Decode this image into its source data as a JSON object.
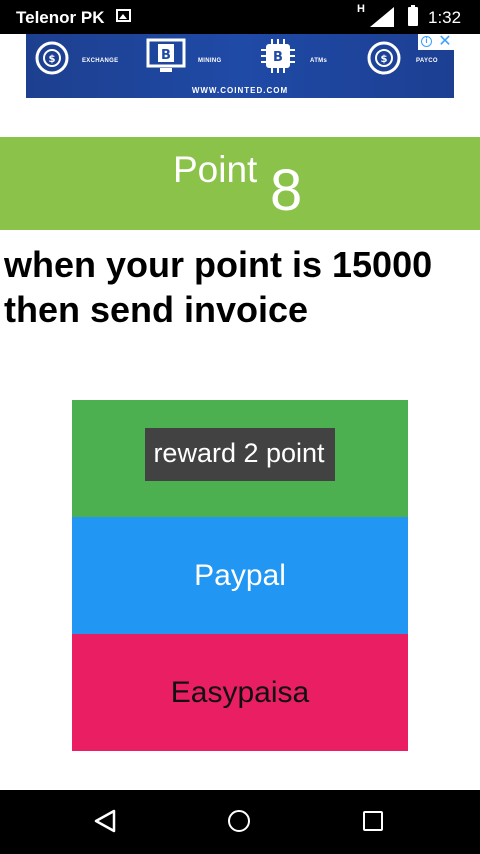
{
  "status_bar": {
    "carrier": "Telenor PK",
    "network_type": "H",
    "time": "1:32",
    "icons": [
      "gallery-icon",
      "signal-icon",
      "battery-icon"
    ]
  },
  "ad": {
    "labels": [
      "EXCHANGE",
      "MINING",
      "ATMs",
      "PAYCO"
    ],
    "url": "WWW.COINTED.COM",
    "icons": [
      "bitcoin-exchange-icon",
      "bitcoin-screen-icon",
      "bitcoin-chip-icon",
      "bitcoin-atm-icon"
    ],
    "close_glyph": "✕",
    "info_glyph": "i",
    "color": "#1f4aa6"
  },
  "points": {
    "label": "Point",
    "value": "8",
    "color": "#8bc34a"
  },
  "info": {
    "text": "when your point is 15000 then send invoice"
  },
  "buttons": {
    "reward": {
      "label": "reward 2 point",
      "color": "#4caf50"
    },
    "paypal": {
      "label": "Paypal",
      "color": "#2196f3"
    },
    "easypaisa": {
      "label": "Easypaisa",
      "color": "#e91e63"
    }
  },
  "nav_bar": {
    "icons": [
      "back-icon",
      "home-icon",
      "recents-icon"
    ]
  }
}
